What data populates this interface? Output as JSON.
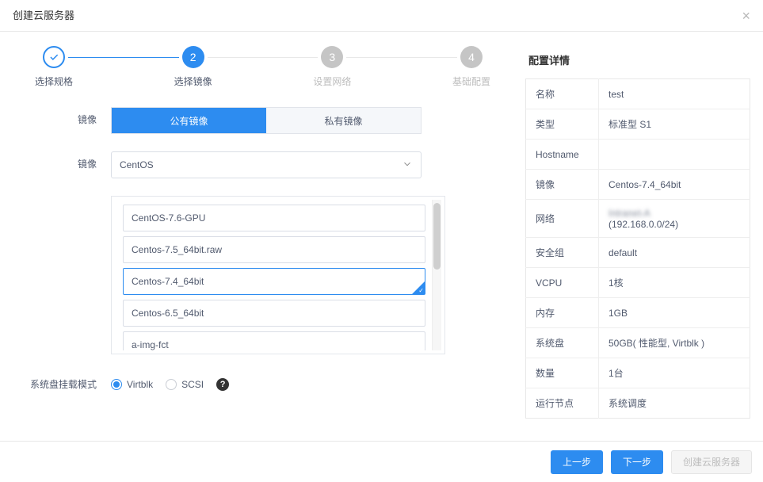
{
  "dialog": {
    "title": "创建云服务器"
  },
  "stepper": {
    "steps": [
      {
        "label": "选择规格",
        "state": "done"
      },
      {
        "label": "选择镜像",
        "num": "2",
        "state": "active"
      },
      {
        "label": "设置网络",
        "num": "3",
        "state": "todo"
      },
      {
        "label": "基础配置",
        "num": "4",
        "state": "todo"
      }
    ]
  },
  "form": {
    "image_label": "镜像",
    "image_tabs": {
      "public": "公有镜像",
      "private": "私有镜像",
      "active": "public"
    },
    "image_os_label": "镜像",
    "image_os_selected": "CentOS",
    "image_list": [
      "CentOS-7.6-GPU",
      "Centos-7.5_64bit.raw",
      "Centos-7.4_64bit",
      "Centos-6.5_64bit",
      "a-img-fct"
    ],
    "image_selected_index": 2,
    "mount_label": "系统盘挂载模式",
    "mount_options": {
      "virtblk": "Virtblk",
      "scsi": "SCSI",
      "checked": "virtblk"
    }
  },
  "details": {
    "title": "配置详情",
    "rows": [
      {
        "k": "名称",
        "v": "test"
      },
      {
        "k": "类型",
        "v": "标准型 S1"
      },
      {
        "k": "Hostname",
        "v": ""
      },
      {
        "k": "镜像",
        "v": "Centos-7.4_64bit"
      },
      {
        "k": "网络",
        "v": "",
        "sub": "(192.168.0.0/24)"
      },
      {
        "k": "安全组",
        "v": "default"
      },
      {
        "k": "VCPU",
        "v": "1核"
      },
      {
        "k": "内存",
        "v": "1GB"
      },
      {
        "k": "系统盘",
        "v": "50GB( 性能型, Virtblk )"
      },
      {
        "k": "数量",
        "v": "1台"
      },
      {
        "k": "运行节点",
        "v": "系统调度"
      }
    ]
  },
  "footer": {
    "prev": "上一步",
    "next": "下一步",
    "submit": "创建云服务器"
  }
}
